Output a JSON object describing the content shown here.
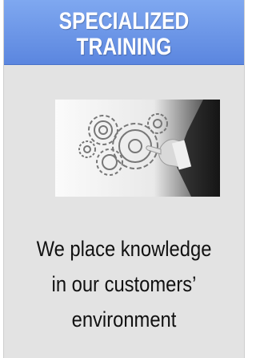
{
  "banner": {
    "title_line1": "SPECIALIZED",
    "title_line2": "TRAINING"
  },
  "image": {
    "icon": "gears-and-hand"
  },
  "tagline": {
    "line1": "We place knowledge",
    "line2": "in our customers’",
    "line3": "environment"
  },
  "colors": {
    "header": "#6b94e8",
    "card": "#e3e3e3",
    "text": "#111111"
  }
}
